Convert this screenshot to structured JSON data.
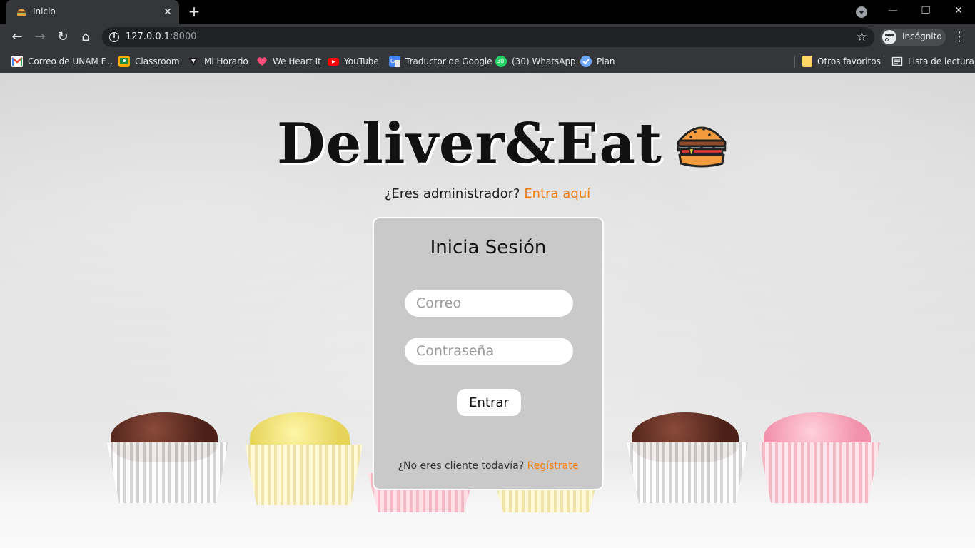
{
  "browser": {
    "tab": {
      "title": "Inicio",
      "close": "✕"
    },
    "new_tab": "+",
    "window_controls": {
      "minimize": "—",
      "restore": "❐",
      "close": "✕"
    },
    "nav": {
      "back": "←",
      "forward": "→",
      "reload": "↻",
      "home": "⌂"
    },
    "address": {
      "host": "127.0.0.1",
      "port": ":8000"
    },
    "bookmark_star": "☆",
    "profile": {
      "label": "Incógnito"
    },
    "menu": "⋮",
    "bookmarks": [
      {
        "label": "Correo de UNAM F...",
        "icon": "gmail-icon",
        "color": "#ea4335"
      },
      {
        "label": "Classroom",
        "icon": "classroom-icon",
        "color": "#f9ab00"
      },
      {
        "label": "Mi Horario",
        "icon": "horario-icon",
        "color": "#111111"
      },
      {
        "label": "We Heart It",
        "icon": "heart-icon",
        "color": "#ff4f7a"
      },
      {
        "label": "YouTube",
        "icon": "youtube-icon",
        "color": "#ff0000"
      },
      {
        "label": "Traductor de Google",
        "icon": "translate-icon",
        "color": "#4285f4"
      },
      {
        "label": "(30) WhatsApp",
        "icon": "whatsapp-icon",
        "color": "#25d366"
      },
      {
        "label": "Plan",
        "icon": "plan-icon",
        "color": "#6fa8ff"
      }
    ],
    "other_bookmarks": "Otros favoritos",
    "reading_list": "Lista de lectura",
    "whatsapp_badge": "30"
  },
  "page": {
    "brand": "Deliver&Eat",
    "admin_prompt": "¿Eres administrador?",
    "admin_link": "Entra aquí",
    "login": {
      "title": "Inicia Sesión",
      "email_placeholder": "Correo",
      "password_placeholder": "Contraseña",
      "submit": "Entrar",
      "register_prompt": "¿No eres cliente todavía?",
      "register_link": "Regístrate"
    }
  },
  "colors": {
    "accent": "#f07d10",
    "card_bg": "#c9c9c9",
    "chrome_bar": "#35363a"
  }
}
